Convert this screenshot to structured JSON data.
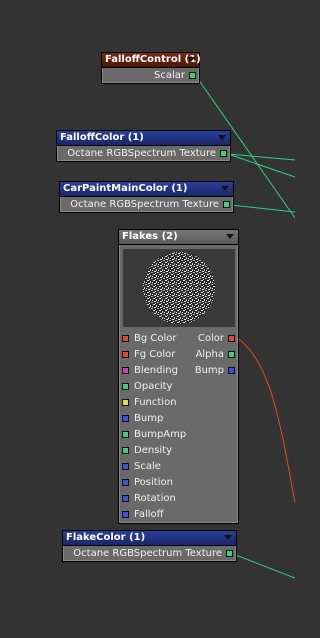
{
  "nodes": {
    "falloff_control": {
      "title": "FalloffControl (1)",
      "output": "Scalar"
    },
    "falloff_color": {
      "title": "FalloffColor (1)",
      "output": "Octane RGBSpectrum Texture"
    },
    "carpaint_main_color": {
      "title": "CarPaintMainColor (1)",
      "output": "Octane RGBSpectrum Texture"
    },
    "flakes": {
      "title": "Flakes (2)",
      "rows": [
        {
          "input": "Bg Color",
          "output": "Color"
        },
        {
          "input": "Fg Color",
          "output": "Alpha"
        },
        {
          "input": "Blending",
          "output": "Bump"
        },
        {
          "input": "Opacity",
          "output": ""
        },
        {
          "input": "Function",
          "output": ""
        },
        {
          "input": "Bump",
          "output": ""
        },
        {
          "input": "BumpAmp",
          "output": ""
        },
        {
          "input": "Density",
          "output": ""
        },
        {
          "input": "Scale",
          "output": ""
        },
        {
          "input": "Position",
          "output": ""
        },
        {
          "input": "Rotation",
          "output": ""
        },
        {
          "input": "Falloff",
          "output": ""
        }
      ]
    },
    "flake_color": {
      "title": "FlakeColor (1)",
      "output": "Octane RGBSpectrum Texture"
    }
  },
  "colors": {
    "background": "#333333",
    "port_green": "#3ad17a",
    "port_red": "#e04a2a",
    "port_blue": "#3a4fe0",
    "port_magenta": "#d23ad2",
    "port_yellow": "#e0e03a",
    "wire_green": "#2ecf8a",
    "wire_red": "#e0472a"
  }
}
